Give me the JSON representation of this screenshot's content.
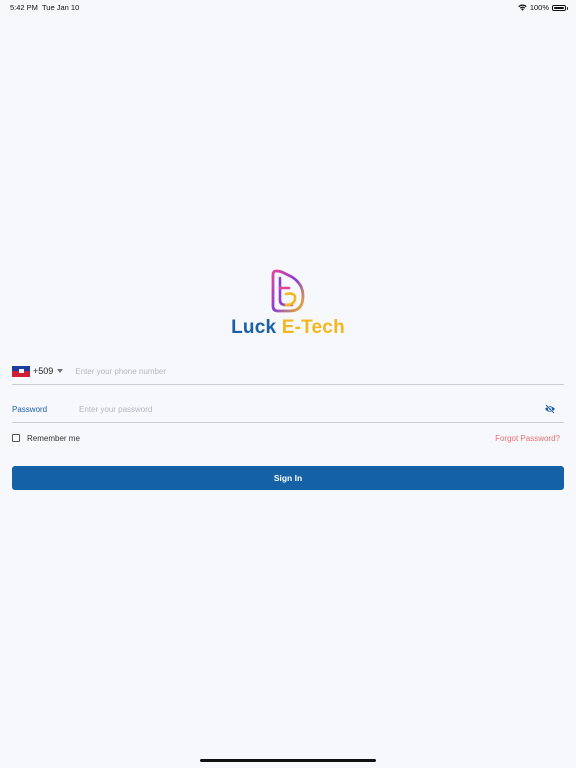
{
  "status_bar": {
    "time": "5:42 PM",
    "date": "Tue Jan 10",
    "battery": "100%",
    "icons": [
      "wifi-icon",
      "battery-icon"
    ]
  },
  "brand": {
    "name_part1": "Luck ",
    "name_part2": "E-Tech",
    "colors": {
      "primary_blue": "#1b5fa6",
      "accent_yellow": "#f2b81e",
      "logo_gradient": [
        "#e0459a",
        "#8a3fd6",
        "#f2b81e"
      ]
    },
    "icon": "luck-etech-logo"
  },
  "login_form": {
    "phone": {
      "country_flag": "haiti-flag-icon",
      "dial_code": "+509",
      "placeholder": "Enter your phone number",
      "value": ""
    },
    "password": {
      "label": "Password",
      "placeholder": "Enter your password",
      "value": "",
      "toggle_icon": "eye-off-icon"
    },
    "remember_me": {
      "label": "Remember me",
      "checked": false
    },
    "forgot_password_label": "Forgot Password?",
    "sign_in_label": "Sign In",
    "button_color": "#1561a5",
    "forgot_color": "#ea6f6f"
  }
}
